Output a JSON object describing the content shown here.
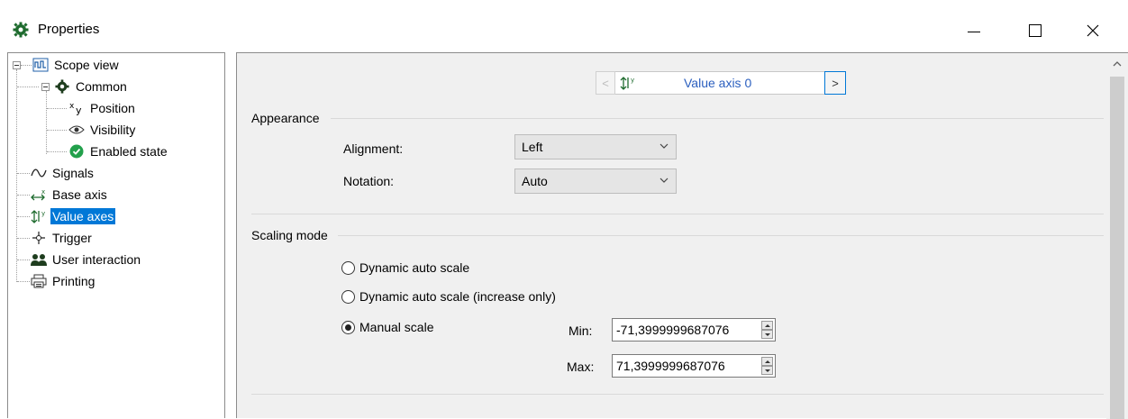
{
  "window": {
    "title": "Properties",
    "controls": {
      "minimize": "minimize",
      "maximize": "maximize",
      "close": "close"
    }
  },
  "tree": {
    "root": {
      "label": "Scope view",
      "icon": "scope-icon"
    },
    "common": {
      "label": "Common",
      "icon": "gear-icon",
      "children": [
        {
          "label": "Position",
          "icon": "xy-icon"
        },
        {
          "label": "Visibility",
          "icon": "eye-icon"
        },
        {
          "label": "Enabled state",
          "icon": "check-circle-icon"
        }
      ]
    },
    "items": [
      {
        "label": "Signals",
        "icon": "wave-icon"
      },
      {
        "label": "Base axis",
        "icon": "base-axis-icon"
      },
      {
        "label": "Value axes",
        "icon": "value-axis-icon",
        "selected": true
      },
      {
        "label": "Trigger",
        "icon": "crosshair-icon"
      },
      {
        "label": "User interaction",
        "icon": "users-icon"
      },
      {
        "label": "Printing",
        "icon": "printer-icon"
      }
    ]
  },
  "navigator": {
    "prev": "<",
    "value": "Value axis 0",
    "next": ">"
  },
  "appearance": {
    "title": "Appearance",
    "alignment_label": "Alignment:",
    "alignment_value": "Left",
    "notation_label": "Notation:",
    "notation_value": "Auto"
  },
  "scaling": {
    "title": "Scaling mode",
    "options": [
      {
        "label": "Dynamic auto scale",
        "checked": false
      },
      {
        "label": "Dynamic auto scale (increase only)",
        "checked": false
      },
      {
        "label": "Manual scale",
        "checked": true
      }
    ],
    "min_label": "Min:",
    "min_value": "-71,3999999687076",
    "max_label": "Max:",
    "max_value": "71,3999999687076"
  },
  "colors": {
    "selection": "#0078d7",
    "panel_bg": "#f0f0f0",
    "nav_text": "#2b5fbf",
    "gear_green": "#1e6b2e",
    "check_green": "#22a04b"
  }
}
